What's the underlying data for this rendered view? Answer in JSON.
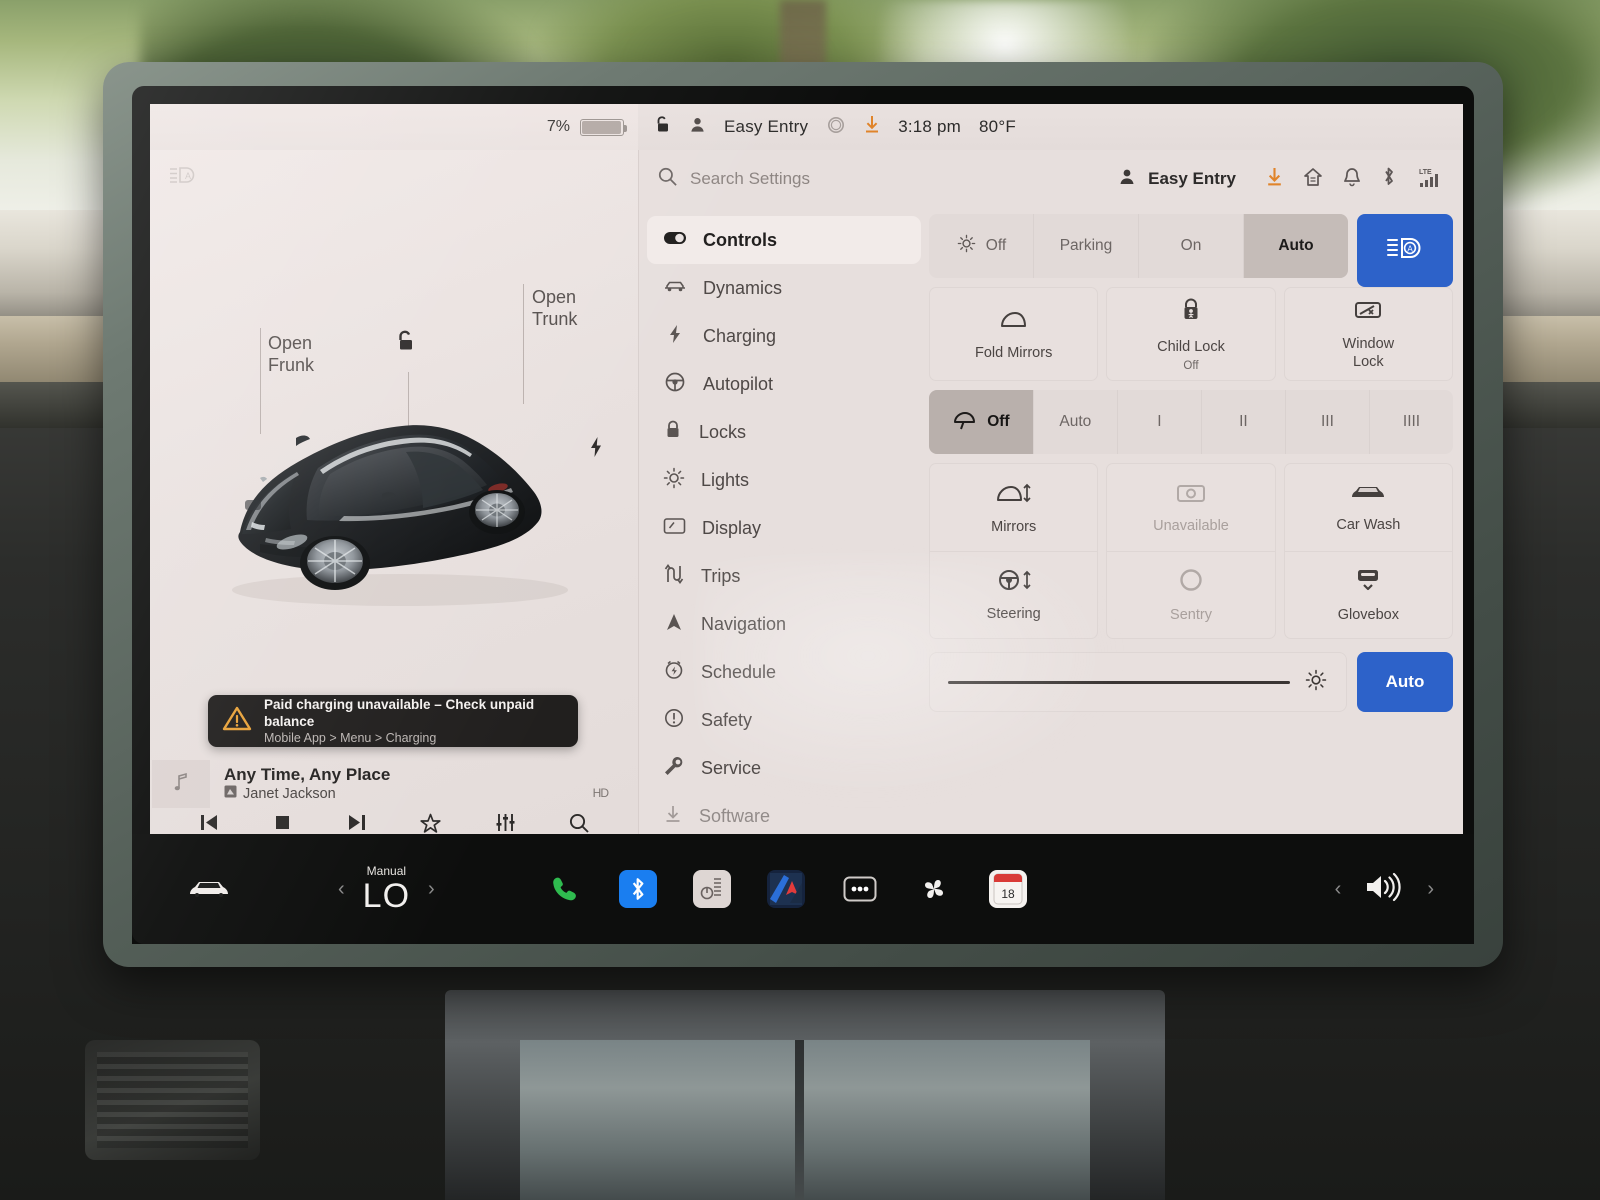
{
  "status_bar": {
    "battery_percent": "7%",
    "lock_icon": "unlocked-padlock-icon",
    "profile_icon": "person-icon",
    "profile_name": "Easy Entry",
    "circle_icon": "circle-icon",
    "download_icon": "download-arrow-icon",
    "time": "3:18 pm",
    "temperature": "80°F"
  },
  "left_pane": {
    "auto_high_beam_icon": "auto-high-beam-icon",
    "frunk_label": "Open\nFrunk",
    "frunk_label_line1": "Open",
    "frunk_label_line2": "Frunk",
    "trunk_label_line1": "Open",
    "trunk_label_line2": "Trunk",
    "lock_icon": "unlocked-padlock-icon",
    "charge_port_icon": "lightning-bolt-icon",
    "vehicle": "black Tesla Model 3 three-quarter render",
    "toast": {
      "icon": "warning-triangle-icon",
      "title": "Paid charging unavailable – Check unpaid balance",
      "subtitle": "Mobile App > Menu > Charging",
      "background": "#211f1e",
      "icon_color": "#e8a23a"
    },
    "media": {
      "album_art_icon": "music-note-icon",
      "track_title": "Any Time, Any Place",
      "artist": "Janet Jackson",
      "source_icon": "radio-source-icon",
      "hd_badge": "HD",
      "controls": [
        {
          "name": "previous-track-button",
          "glyph": "⏮"
        },
        {
          "name": "stop-button",
          "glyph": "■"
        },
        {
          "name": "next-track-button",
          "glyph": "⏭"
        },
        {
          "name": "favorite-star-button",
          "glyph": "☆"
        },
        {
          "name": "equalizer-button",
          "glyph": "≡"
        },
        {
          "name": "media-search-button",
          "glyph": "⌕"
        }
      ]
    }
  },
  "settings": {
    "search": {
      "icon": "search-icon",
      "placeholder": "Search Settings"
    },
    "header": {
      "profile_icon": "person-icon",
      "profile_name": "Easy Entry",
      "icons": [
        "download-arrow-icon",
        "home-icon",
        "bell-icon",
        "bluetooth-icon",
        "lte-signal-icon"
      ],
      "lte_label": "LTE"
    },
    "nav_items": [
      {
        "label": "Controls",
        "icon": "toggle-switch-icon",
        "active": true
      },
      {
        "label": "Dynamics",
        "icon": "car-icon",
        "active": false
      },
      {
        "label": "Charging",
        "icon": "lightning-bolt-icon",
        "active": false
      },
      {
        "label": "Autopilot",
        "icon": "steering-wheel-icon",
        "active": false
      },
      {
        "label": "Locks",
        "icon": "padlock-icon",
        "active": false
      },
      {
        "label": "Lights",
        "icon": "sun-icon",
        "active": false
      },
      {
        "label": "Display",
        "icon": "screen-icon",
        "active": false
      },
      {
        "label": "Trips",
        "icon": "route-icon",
        "active": false
      },
      {
        "label": "Navigation",
        "icon": "navigation-arrow-icon",
        "active": false
      },
      {
        "label": "Schedule",
        "icon": "clock-bolt-icon",
        "active": false
      },
      {
        "label": "Safety",
        "icon": "exclamation-circle-icon",
        "active": false
      },
      {
        "label": "Service",
        "icon": "wrench-icon",
        "active": false
      },
      {
        "label": "Software",
        "icon": "download-icon",
        "active": false
      }
    ],
    "headlights": {
      "icon": "headlight-sun-icon",
      "options": [
        "Off",
        "Parking",
        "On",
        "Auto"
      ],
      "selected": "Auto",
      "auto_high_beam_button": {
        "icon": "auto-high-beam-icon",
        "active": true,
        "color": "#2d62c9"
      }
    },
    "mirror_row": [
      {
        "label": "Fold Mirrors",
        "icon": "mirror-icon",
        "sub": "",
        "dim": false
      },
      {
        "label": "Child Lock",
        "icon": "child-lock-icon",
        "sub": "Off",
        "dim": false
      },
      {
        "label": "Window\nLock",
        "label_line1": "Window",
        "label_line2": "Lock",
        "icon": "window-lock-icon",
        "sub": "",
        "dim": false
      }
    ],
    "wipers": {
      "icon": "wiper-icon",
      "options": [
        "Off",
        "Auto",
        "I",
        "II",
        "III",
        "IIII"
      ],
      "selected": "Off"
    },
    "tile_grid": [
      [
        {
          "label": "Mirrors",
          "icon": "mirror-adjust-icon",
          "dim": false
        },
        {
          "label": "Unavailable",
          "icon": "camera-icon",
          "dim": true
        },
        {
          "label": "Car Wash",
          "icon": "car-front-icon",
          "dim": false
        }
      ],
      [
        {
          "label": "Steering",
          "icon": "steering-adjust-icon",
          "dim": false
        },
        {
          "label": "Sentry",
          "icon": "sentry-circle-icon",
          "dim": true
        },
        {
          "label": "Glovebox",
          "icon": "glovebox-icon",
          "dim": false
        }
      ]
    ],
    "brightness": {
      "slider_value_percent": 93,
      "sun_icon": "brightness-sun-icon",
      "auto_label": "Auto",
      "auto_active": true,
      "auto_color": "#2d62c9"
    }
  },
  "taskbar": {
    "car_icon": "car-front-icon",
    "climate": {
      "prev_icon": "chevron-left-icon",
      "mode_label": "Manual",
      "temperature": "LO",
      "next_icon": "chevron-right-icon"
    },
    "apps": [
      {
        "name": "phone-app-icon",
        "glyph": "✆",
        "color": "#2fbb4f",
        "bg": "transparent"
      },
      {
        "name": "bluetooth-app-icon",
        "glyph": "ᛗ",
        "color": "#ffffff",
        "bg": "#1a7ef0"
      },
      {
        "name": "tesla-app-icon",
        "glyph": "",
        "color": "#6a6260",
        "bg": "#ded6d3"
      },
      {
        "name": "navigation-app-icon",
        "glyph": "➤",
        "color": "#e23b3b",
        "bg": "#15233d"
      },
      {
        "name": "more-apps-icon",
        "glyph": "•••",
        "color": "#ffffff",
        "bg": "transparent"
      },
      {
        "name": "climate-fan-icon",
        "glyph": "",
        "color": "#f2f0ee",
        "bg": "transparent"
      },
      {
        "name": "calendar-app-icon",
        "glyph": "18",
        "color": "#2b2b2b",
        "bg": "#f5f2ef"
      }
    ],
    "calendar_day": "18",
    "volume": {
      "prev_icon": "chevron-left-icon",
      "speaker_icon": "speaker-volume-icon",
      "next_icon": "chevron-right-icon"
    }
  },
  "colors": {
    "screen_bg": "#ebe5e3",
    "accent_blue": "#2d62c9",
    "selected_gray": "#c5bcb8",
    "warning_orange": "#e8a23a",
    "text_dark": "#201e1d",
    "text_muted": "#6d6664"
  }
}
